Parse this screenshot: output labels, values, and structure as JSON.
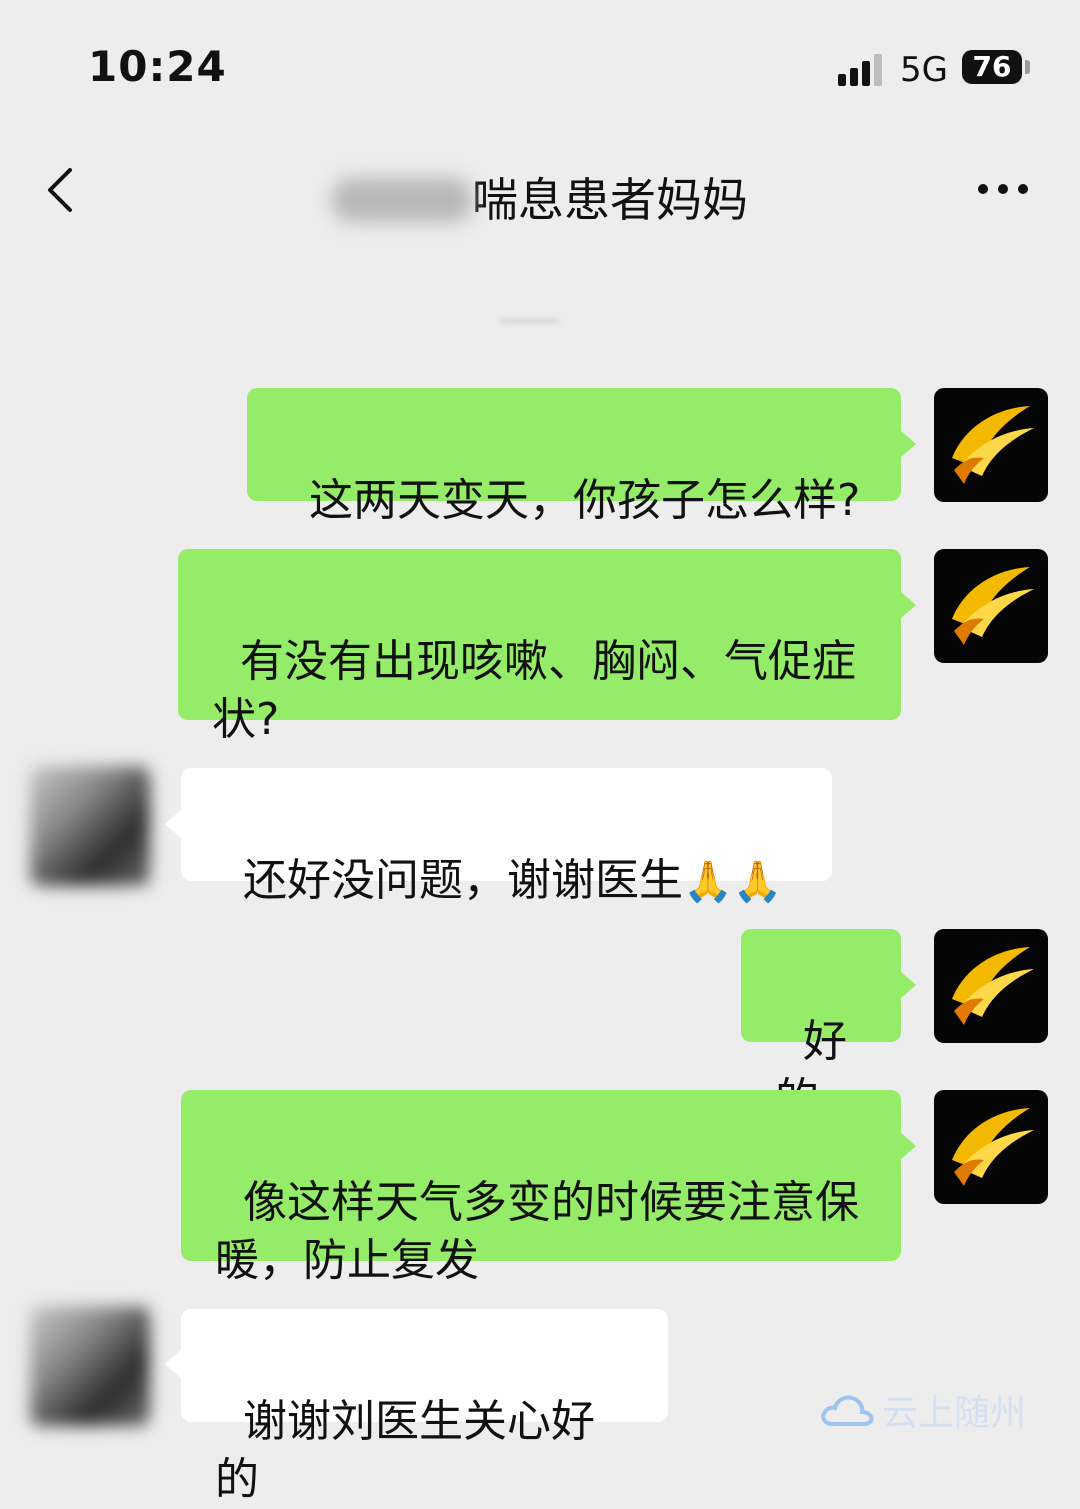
{
  "status_bar": {
    "time": "10:24",
    "network": "5G",
    "battery": "76"
  },
  "header": {
    "title": "喘息患者妈妈"
  },
  "messages": [
    {
      "direction": "out",
      "text": "这两天变天，你孩子怎么样?"
    },
    {
      "direction": "out",
      "text": "有没有出现咳嗽、胸闷、气促症\n状?"
    },
    {
      "direction": "in",
      "text": "还好没问题，谢谢医生",
      "emoji": "🙏🙏"
    },
    {
      "direction": "out",
      "text": "好的"
    },
    {
      "direction": "out",
      "text": "像这样天气多变的时候要注意保\n暖，防止复发"
    },
    {
      "direction": "in",
      "text": "谢谢刘医生关心好的"
    }
  ],
  "watermark": {
    "text": "云上随州"
  }
}
